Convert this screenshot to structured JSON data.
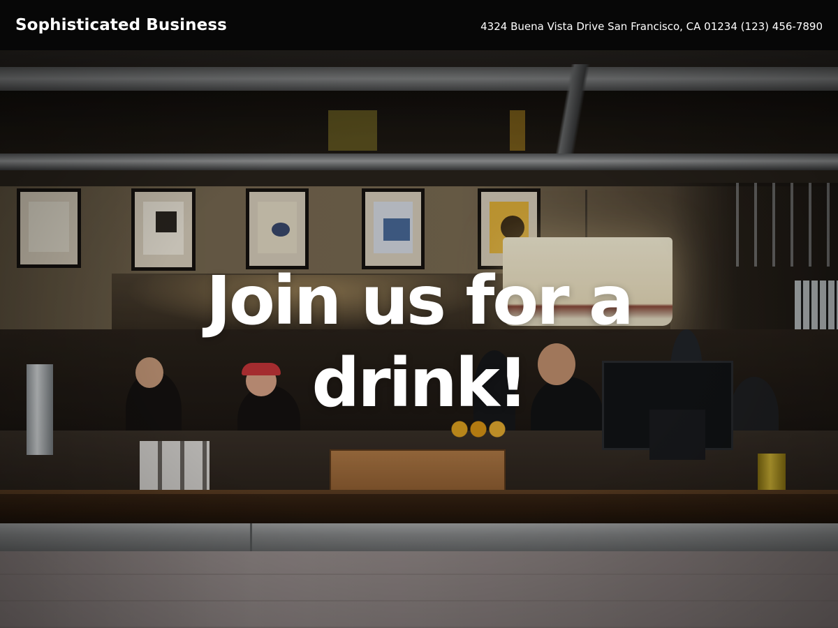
{
  "header": {
    "brand": "Sophisticated Business",
    "address": "4324 Buena Vista Drive San Francisco, CA 01234",
    "phone": "(123) 456-7890"
  },
  "hero": {
    "headline": "Join us for a drink!"
  },
  "colors": {
    "header_background": "#070707",
    "text": "#ffffff"
  }
}
